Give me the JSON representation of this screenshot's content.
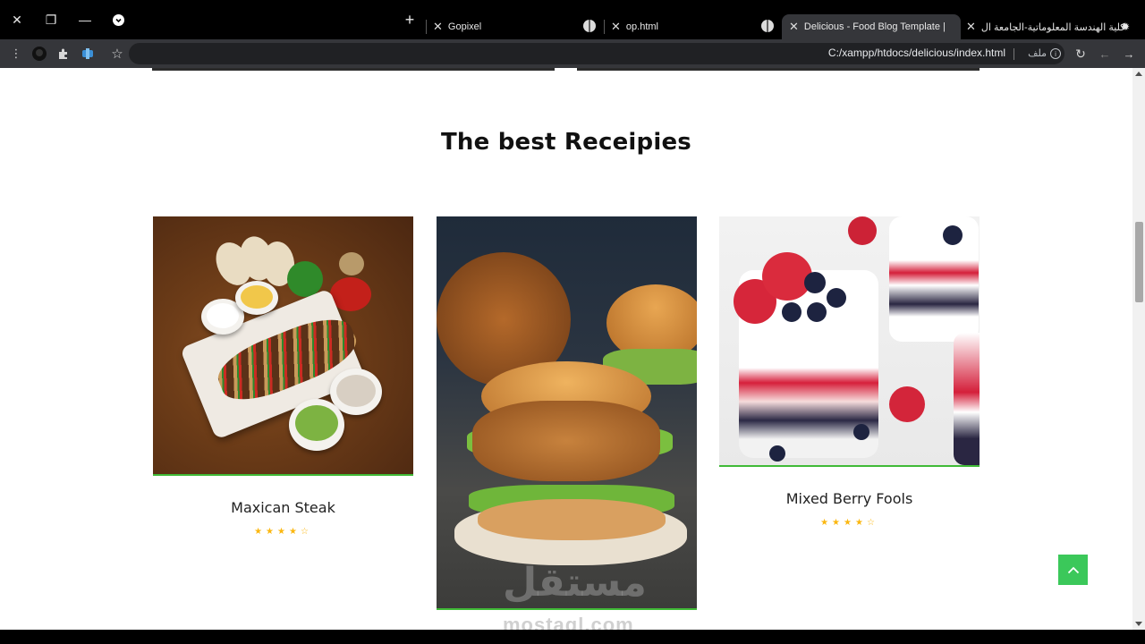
{
  "browser": {
    "tabs": [
      {
        "label": "Gopixel"
      },
      {
        "label": "op.html"
      },
      {
        "label": "Delicious - Food Blog Template |"
      },
      {
        "label": "كلية الهندسة المعلوماتية-الجامعة ال"
      }
    ],
    "url": "C:/xampp/htdocs/delicious/index.html",
    "url_label": "ملف",
    "icons": [
      "close-icon",
      "restore-icon",
      "minimize-icon",
      "tab-search-icon",
      "new-tab-icon",
      "globe-icon",
      "menu-icon",
      "extensions-icon",
      "star-icon",
      "reload-icon",
      "back-icon",
      "forward-icon"
    ]
  },
  "section": {
    "title": "The best Receipies"
  },
  "recipes": [
    {
      "name": "Maxican Steak",
      "rating": 4,
      "stars": "★★★★☆"
    },
    {
      "name": "",
      "rating": null
    },
    {
      "name": "Mixed Berry Fools",
      "rating": 4,
      "stars": "★★★★☆"
    }
  ],
  "watermark": {
    "text": "mostaql.com",
    "arabic": "مستقل"
  },
  "colors": {
    "accent": "#40ba37",
    "stars": "#fbb710",
    "to_top": "#3bc85a"
  }
}
